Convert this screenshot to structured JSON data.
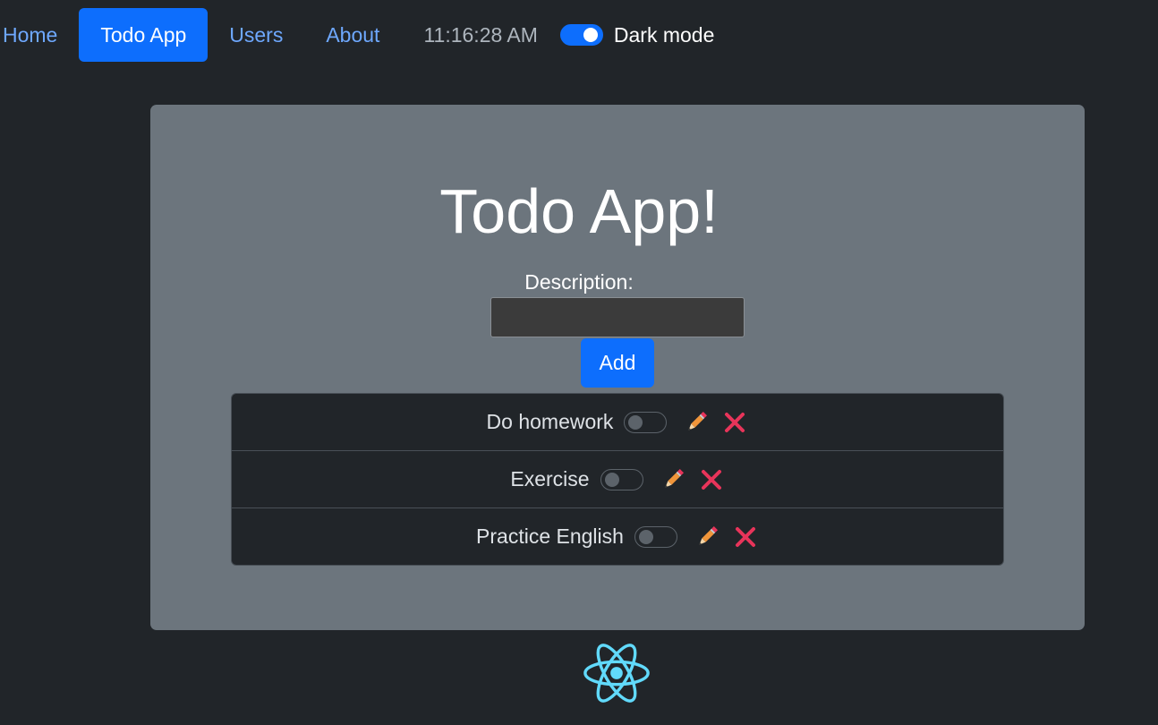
{
  "nav": {
    "links": [
      {
        "label": "Home",
        "active": false
      },
      {
        "label": "Todo App",
        "active": true
      },
      {
        "label": "Users",
        "active": false
      },
      {
        "label": "About",
        "active": false
      }
    ],
    "clock": "11:16:28 AM",
    "dark_mode": {
      "label": "Dark mode",
      "on": true
    }
  },
  "main": {
    "title": "Todo App!",
    "description_label": "Description:",
    "description_value": "",
    "add_label": "Add",
    "todos": [
      {
        "text": "Do homework",
        "done": false
      },
      {
        "text": "Exercise",
        "done": false
      },
      {
        "text": "Practice English",
        "done": false
      }
    ]
  },
  "icons": {
    "edit": "pencil-icon",
    "delete": "close-icon",
    "logo": "react-logo-icon"
  },
  "colors": {
    "background": "#212529",
    "card": "#6c757d",
    "primary": "#0d6efd",
    "link": "#6ea8fe",
    "pencil": "#f0953a",
    "delete": "#e8345a",
    "react": "#61dafb"
  }
}
